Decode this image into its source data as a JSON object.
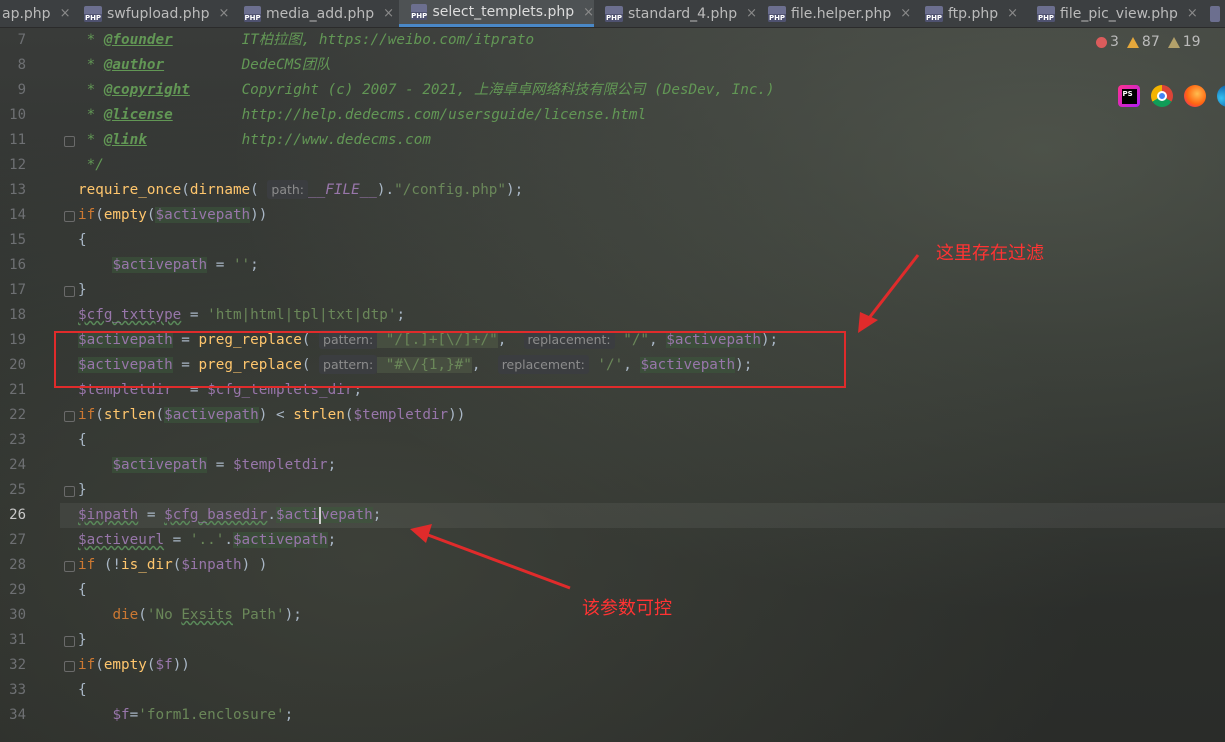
{
  "tabs": [
    {
      "label": "ap.php",
      "active": false
    },
    {
      "label": "swfupload.php",
      "active": false
    },
    {
      "label": "media_add.php",
      "active": false
    },
    {
      "label": "select_templets.php",
      "active": true
    },
    {
      "label": "standard_4.php",
      "active": false
    },
    {
      "label": "file.helper.php",
      "active": false
    },
    {
      "label": "ftp.php",
      "active": false
    },
    {
      "label": "file_pic_view.php",
      "active": false
    }
  ],
  "php_icon_text": "PHP",
  "tab_close_glyph": "×",
  "inspections": {
    "errors": "3",
    "warnings": "87",
    "weak_warnings": "19"
  },
  "browser_icons": [
    "phpstorm-icon",
    "chrome-icon",
    "firefox-icon",
    "edge-icon"
  ],
  "phpstorm_icon_text": "PS",
  "line_numbers": [
    "7",
    "8",
    "9",
    "10",
    "11",
    "12",
    "13",
    "14",
    "15",
    "16",
    "17",
    "18",
    "19",
    "20",
    "21",
    "22",
    "23",
    "24",
    "25",
    "26",
    "27",
    "28",
    "29",
    "30",
    "31",
    "32",
    "33",
    "34"
  ],
  "current_line": "26",
  "code": {
    "l7": {
      "star": " * ",
      "tag": "@founder",
      "pad": "        ",
      "text": "IT柏拉图, https://weibo.com/itprato"
    },
    "l8": {
      "star": " * ",
      "tag": "@author",
      "pad": "         ",
      "text": "DedeCMS团队"
    },
    "l9": {
      "star": " * ",
      "tag": "@copyright",
      "pad": "      ",
      "text": "Copyright (c) 2007 - 2021, 上海卓卓网络科技有限公司 (DesDev, Inc.)"
    },
    "l10": {
      "star": " * ",
      "tag": "@license",
      "pad": "        ",
      "text": "http://help.dedecms.com/usersguide/license.html"
    },
    "l11": {
      "star": " * ",
      "tag": "@link",
      "pad": "           ",
      "text": "http://www.dedecms.com"
    },
    "l12": {
      "text": " */"
    },
    "l13": {
      "fn": "require_once",
      "open": "(",
      "fn2": "dirname",
      "open2": "( ",
      "hint": "path:",
      "const": "__FILE__",
      "rest": ").",
      "str": "\"/config.php\"",
      "end": ");"
    },
    "l14": {
      "kw": "if",
      "p1": "(",
      "fn": "empty",
      "p2": "(",
      "var": "$activepath",
      "p3": "))"
    },
    "l15": {
      "text": "{"
    },
    "l16": {
      "indent": "    ",
      "var": "$activepath",
      "op": " = ",
      "str": "''",
      "end": ";"
    },
    "l17": {
      "text": "}"
    },
    "l18": {
      "var": "$cfg_txttype",
      "op": " = ",
      "str": "'htm|html|tpl|txt|dtp'",
      "end": ";"
    },
    "l19": {
      "var": "$activepath",
      "op": " = ",
      "fn": "preg_replace",
      "open": "( ",
      "hint1": "pattern:",
      "str1": " \"/[.]+[\\/]+/\"",
      "comma": ",  ",
      "hint2": "replacement:",
      "str2": " \"/\"",
      "comma2": ", ",
      "var2": "$activepath",
      "end": ");"
    },
    "l20": {
      "var": "$activepath",
      "op": " = ",
      "fn": "preg_replace",
      "open": "( ",
      "hint1": "pattern:",
      "str1": " \"#\\/{1,}#\"",
      "comma": ",  ",
      "hint2": "replacement:",
      "str2": " '/'",
      "comma2": ", ",
      "var2": "$activepath",
      "end": ");"
    },
    "l21": {
      "var": "$templetdir",
      "op": "  = ",
      "var2": "$cfg_templets_dir",
      "end": ";"
    },
    "l22": {
      "kw": "if",
      "p1": "(",
      "fn": "strlen",
      "p2": "(",
      "var": "$activepath",
      "mid": ") < ",
      "fn2": "strlen",
      "p3": "(",
      "var2": "$templetdir",
      "end": "))"
    },
    "l23": {
      "text": "{"
    },
    "l24": {
      "indent": "    ",
      "var": "$activepath",
      "op": " = ",
      "var2": "$templetdir",
      "end": ";"
    },
    "l25": {
      "text": "}"
    },
    "l26": {
      "var": "$inpath",
      "op": " = ",
      "var2": "$cfg_basedir",
      "dot": ".",
      "var3a": "$acti",
      "var3b": "vepath",
      "end": ";"
    },
    "l27": {
      "var": "$activeurl",
      "op": " = ",
      "str": "'..'",
      "dot": ".",
      "var2": "$activepath",
      "end": ";"
    },
    "l28": {
      "kw": "if",
      "p1": " (!",
      "fn": "is_dir",
      "p2": "(",
      "var": "$inpath",
      "end": ") )"
    },
    "l29": {
      "text": "{"
    },
    "l30": {
      "indent": "    ",
      "fn": "die",
      "p1": "(",
      "str1": "'No ",
      "str2": "Exsits",
      "str3": " Path'",
      "end": ");"
    },
    "l31": {
      "text": "}"
    },
    "l32": {
      "kw": "if",
      "p1": "(",
      "fn": "empty",
      "p2": "(",
      "var": "$f",
      "end": "))"
    },
    "l33": {
      "text": "{"
    },
    "l34": {
      "indent": "    ",
      "var": "$f",
      "op": "=",
      "str": "'form1.enclosure'",
      "end": ";"
    }
  },
  "annotations": {
    "filter_note": "这里存在过滤",
    "param_note": "该参数可控"
  },
  "colors": {
    "annotation_red": "#e02b2b",
    "keyword": "#cc7832",
    "function": "#ffc66d",
    "variable": "#9876aa",
    "string": "#6a8759",
    "comment": "#629755"
  }
}
